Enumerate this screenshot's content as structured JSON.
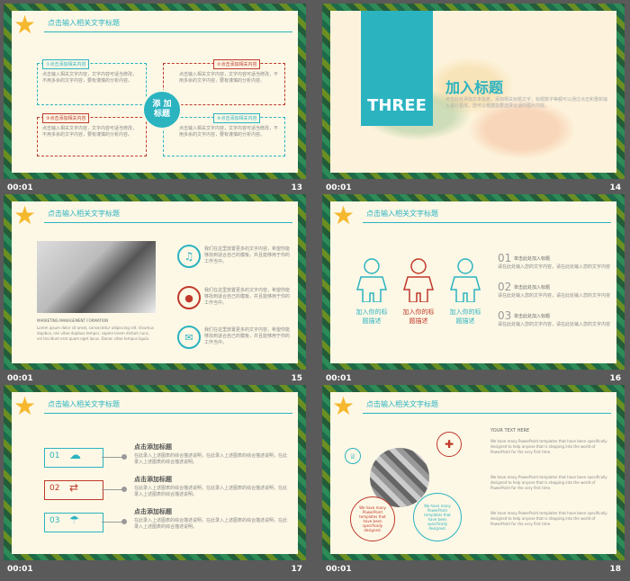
{
  "slides": [
    {
      "time": "00:01",
      "number": "13",
      "title": "点击输入相关文字标题",
      "center": "添 加\n标题",
      "items": [
        {
          "label": "①点击添加相关内容",
          "text": "点击输入相关文字内容，文字内容可适当修改，不用多余的文字内容，要有谨慎的分析内容。"
        },
        {
          "label": "②点击添加相关内容",
          "text": "点击输入相关文字内容，文字内容可适当修改，不用多余的文字内容，要有谨慎的分析内容。"
        },
        {
          "label": "③点击添加相关内容",
          "text": "点击输入相关文字内容，文字内容可适当修改，不用多余的文字内容，要有谨慎的分析内容。"
        },
        {
          "label": "④点击添加相关内容",
          "text": "点击输入相关文字内容，文字内容可适当修改，不用多余的文字内容，要有谨慎的分析内容。"
        }
      ]
    },
    {
      "time": "00:01",
      "number": "14",
      "section": "THREE",
      "heading": "加入标题",
      "text": "点击此处添加文本信息，添加相关标题文字，标题数字等都可以通过点击和重新输入进行更改，您可以根据需要选择合适的图片内容。"
    },
    {
      "time": "00:01",
      "number": "15",
      "title": "点击输入相关文字标题",
      "caption": "MARKETING MANAGEMENT FORMATION",
      "para": "Lorem ipsum dolor sit amet, consectetur adipiscing elit. Vivamus dapibus, nisi vitae dapibus tempor, sapien lorem dictum nunc, vel tincidunt erat quam eget lacus. Donec vitae tempus ligula.",
      "points": [
        {
          "text": "我们在这里放置更多的文字内容，希望你能够找到适合自己的模板，并且能够用于你的工作当中。"
        },
        {
          "text": "我们在这里放置更多的文字内容，希望你能够找到适合自己的模板，并且能够用于你的工作当中。"
        },
        {
          "text": "我们在这里放置更多的文字内容，希望你能够找到适合自己的模板，并且能够用于你的工作当中。"
        }
      ]
    },
    {
      "time": "00:01",
      "number": "16",
      "title": "点击输入相关文字标题",
      "people": [
        {
          "label": "加入你的标\n题描述"
        },
        {
          "label": "加入你的标\n题描述"
        },
        {
          "label": "加入你的标\n题描述"
        }
      ],
      "list": [
        {
          "num": "01",
          "title": "单击此处加入标题",
          "text": "请在此处输入您的文字内容，请在此处输入您的文字内容"
        },
        {
          "num": "02",
          "title": "单击此处加入标题",
          "text": "请在此处输入您的文字内容，请在此处输入您的文字内容"
        },
        {
          "num": "03",
          "title": "单击此处加入标题",
          "text": "请在此处输入您的文字内容，请在此处输入您的文字内容"
        }
      ]
    },
    {
      "time": "00:01",
      "number": "17",
      "title": "点击输入相关文字标题",
      "rows": [
        {
          "num": "01",
          "heading": "点击添加标题",
          "text": "在此录入上述图表的综合描述说明，在此录入上述图表的综合描述说明，在此录入上述图表的综合描述说明。"
        },
        {
          "num": "02",
          "heading": "点击添加标题",
          "text": "在此录入上述图表的综合描述说明，在此录入上述图表的综合描述说明，在此录入上述图表的综合描述说明。"
        },
        {
          "num": "03",
          "heading": "点击添加标题",
          "text": "在此录入上述图表的综合描述说明，在此录入上述图表的综合描述说明，在此录入上述图表的综合描述说明。"
        }
      ]
    },
    {
      "time": "00:01",
      "number": "18",
      "title": "点击输入相关文字标题",
      "subtitle": "YOUR TEXT HERE",
      "circle_left": "We have many PowerPoint templates that have been specifically designed.",
      "circle_right": "We have many PowerPoint templates that have been specifically designed.",
      "lines": [
        "We have many PowerPoint templates that have been specifically designed to help anyone that is stepping into the world of PowerPoint for the very first time.",
        "We have many PowerPoint templates that have been specifically designed to help anyone that is stepping into the world of PowerPoint for the very first time.",
        "We have many PowerPoint templates that have been specifically designed to help anyone that is stepping into the world of PowerPoint for the very first time."
      ]
    }
  ]
}
